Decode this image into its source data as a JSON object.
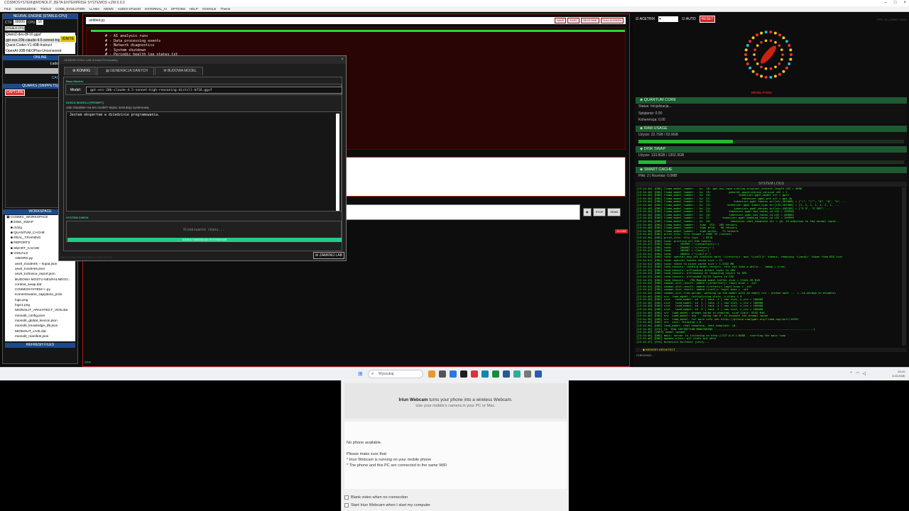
{
  "window": {
    "title": "COSMOSYSTEM@MONOLIT_BETA ENTERPRISE SYSTEMOS v.ZM 6.0.0",
    "menu": [
      "FILE",
      "KNOWLEDGE",
      "TOOLS",
      "CODE_EVOLUTION",
      "LLAMA",
      "NEWS",
      "AUDIO STUDIO",
      "EXTERNAL_AI",
      "OPTIONS",
      "HELP",
      "GOOGLE",
      "Theme"
    ]
  },
  "sidebar": {
    "engine_header": "NEURAL ENGINE [STABLE-CPU]",
    "ctx_label": "CTX",
    "ctx_value": "99999",
    "cpu_label": "CPU",
    "cpu_value": "16",
    "model_select": "[STABLE CPU]",
    "ignite": "IGNITE",
    "models": [
      "Qwen2-dev-8F16.gguf",
      "gpt-oss-20b-claude-4.5-sonnet-high-rea",
      "Quest-Coder-V1-40B-Instruct",
      "OpenAI-20B-NEOPlus-Uncensored"
    ],
    "status": "ONLINE",
    "loading": "Ładowanie: 0%",
    "cache": "CACHE ON",
    "quarks_header": "QUARKS (SNIPPETS)",
    "capture": "CAPTURE",
    "workspace_header": "WORKSPACE",
    "tree": [
      {
        "label": "COSMIC_WORKSPACE",
        "depth": 0
      },
      {
        "label": "DISK_SWAP",
        "depth": 1
      },
      {
        "label": "mózg",
        "depth": 1
      },
      {
        "label": "QUANTUM_CACHE",
        "depth": 1
      },
      {
        "label": "REAL_TRAINING",
        "depth": 1
      },
      {
        "label": "REPORTS",
        "depth": 1
      },
      {
        "label": "SMART_CACHE",
        "depth": 1
      },
      {
        "label": "VISUALS",
        "depth": 1
      },
      {
        "label": "AIBORG.py",
        "depth": 2
      },
      {
        "label": "arwir_incidents -- kopia.json",
        "depth": 2
      },
      {
        "label": "arwir_incidents.json",
        "depth": 2
      },
      {
        "label": "arwir_turbosca_report.json",
        "depth": 2
      },
      {
        "label": "BUDOWA MOSTU NEURALNEGO...",
        "depth": 2
      },
      {
        "label": "context_swap.dat",
        "depth": 2
      },
      {
        "label": "COSMOSYSTEM++.py",
        "depth": 2
      },
      {
        "label": "Komentowane_zapytania_prob",
        "depth": 2
      },
      {
        "label": "logo.png",
        "depth": 2
      },
      {
        "label": "logo1.png",
        "depth": 2
      },
      {
        "label": "MIONOLIT_ARCHITECT_VDN.dat",
        "depth": 2
      },
      {
        "label": "mionolit_config.json",
        "depth": 2
      },
      {
        "label": "mionolit_global_lexicon.json",
        "depth": 2
      },
      {
        "label": "mionolit_knowledge_db.json",
        "depth": 2
      },
      {
        "label": "MIONOUT_LIVE.dat",
        "depth": 2
      },
      {
        "label": "mionolit_manifest.json",
        "depth": 2
      }
    ],
    "refresh": "REFRESH FILES"
  },
  "editor": {
    "file": "untitled.py",
    "buttons": [
      "SAVE",
      "EXEC",
      "RESTORE",
      "FULLSCREEN"
    ],
    "code": "  # - AI analysis runs\n  # - Data processing events\n  # - Network diagnostics\n  # - System shutdown\n  # - Periodic health log states.txt",
    "send_buttons": [
      "STOP",
      "SEND"
    ],
    "terminal_prompt": ">>>",
    "close_tag": "CLOSE"
  },
  "right_panel": {
    "acetrix": "ACETRIX",
    "auto": "AUTO",
    "reset": "RESET",
    "faint": "FPS: 18  |  ORBIT: 100%",
    "revelation": "REVELATION",
    "quantum_header": "QUANTUM CORE",
    "quantum_lines": [
      "Status: Inicjalizacja...",
      "Splątanie: 0.00",
      "Koherencja: 0.00"
    ],
    "ram_header": "RAM USAGE",
    "ram_text": "Użycie: 22.7GB / 63.9GB",
    "ram_fraction": 0.355,
    "disk_header": "DISK SWAP",
    "disk_text": "Użycie: 133.9GB / 1302.3GB",
    "disk_fraction": 0.103,
    "smart_header": "SMART CACHE",
    "smart_text": "Pliki: 2 | Rozmiar: 0.0MB",
    "syslog_header": "SYSTEM LOGS",
    "syslog": "[13:14:40] [DBG] llama_model_loader: - kv  18: gpt-oss.rope.scaling.original_context_length u32 = 4096\n[13:14:40] [DBG] llama_model_loader: - kv  19:           general.quantization_version u32 = 2\n[13:14:40] [DBG] llama_model_loader: - kv  20:                 tokenizer.ggml.model str = gpt2\n[13:14:40] [DBG] llama_model_loader: - kv  21:                   tokenizer.ggml.pre str = gpt-4o\n[13:14:40] [DBG] llama_model_loader: - kv  22:              tokenizer.ggml.tokens arr[str,201088] = [\"!\", \"\\\"\", \"#\", \"$\", \"%\", ...\n[13:14:40] [DBG] llama_model_loader: - kv  23:          tokenizer.ggml.token_type arr[i32,201088] = [1, 1, 1, 1, 1, 1, 1, ...\n[13:14:40] [DBG] llama_model_loader: - kv  24:              tokenizer.ggml.merges arr[str,446189] = [\"Ġ Ġ\", \"Ġ ĠĠĠ\", ...\n[13:14:40] [DBG] llama_model_loader: - kv  25:           tokenizer.ggml.bos_token_id u32 = 199998\n[13:14:40] [DBG] llama_model_loader: - kv  26:           tokenizer.ggml.eos_token_id u32 = 200002\n[13:14:40] [DBG] llama_model_loader: - kv  27:       tokenizer.ggml.padding_token_id u32 = 199999\n[13:14:40] [DBG] llama_model_loader: - kv  28:            tokenizer.chat_template str = {#- In addition to the normal input...\n[13:14:40] [DBG] llama_model_loader: - type  f32:  289 tensors\n[13:14:40] [DBG] llama_model_loader: - type bf16:   98 tensors\n[13:14:40] [DBG] llama_model_loader: - type mxfp4:   72 tensors\n[13:14:40] [DBG] print_info: file format = GGUF V3 (latest)\n[13:14:40] [DBG] print_info: file type   = BF16\n[13:14:41] [DBG] load: printing all EOG tokens:\n[13:14:41] [DBG] load:   - 199999 ('<|endoftext|>')\n[13:14:41] [DBG] load:   - 200002 ('<|return|>')\n[13:14:41] [DBG] load:   - 200007 ('<|end|>')\n[13:14:41] [DBG] load:   - 200012 ('<|call|>')\n[13:14:41] [DBG] load: special_eog_ids contains both '<|return|>' and '<|call|>' tokens, removing '<|end|>' token from EOG list\n[13:14:41] [DBG] load: special tokens cache size = 21\n[13:14:41] [DBG] load: token to piece cache size = 1.3332 MB\n[13:14:41] [DBG] load_tensors: loading model tensors, this can take a while... (mmap = true)\n[13:14:43] [DBG] load_tensors: offloading output layer to GPU\n[13:14:43] [DBG] load_tensors: offloading 24 repeating layers to GPU\n[13:14:43] [DBG] load_tensors: offloaded 25/25 layers to GPU\n[13:14:43] [DBG] load_tensors:   CPU_Mapped model buffer size = 13141.38 MiB\n[13:14:44] [DBG] common_init_result: added <|endoftext|> logit bias = -inf\n[13:14:44] [DBG] common_init_result: added <|return|> logit bias = -inf\n[13:14:44] [DBG] common_init_result: added <|call|> logit bias = -inf\n[13:14:44] [DBG] common_init_from_params: warming up the model with an empty run - please wait ... (--no-warmup to disable)\n[13:14:46] [DBG] srv  load_model: initializing slots, n_slots = 4\n[13:14:46] [DBG] slot   load_model: id  0 | task -1 | new slot, n_ctx = 100000\n[13:14:46] [DBG] slot   load_model: id  1 | task -1 | new slot, n_ctx = 100000\n[13:14:46] [DBG] slot   load_model: id  2 | task -1 | new slot, n_ctx = 100000\n[13:14:46] [DBG] slot   load_model: id  3 | task -1 | new slot, n_ctx = 100000\n[13:14:46] [DBG] srv  load_model: prompt cache is enabled, size limit: 8192 MiB\n[13:14:46] [DBG] srv  load_model: use `--cache-ram 0` to disable the prompt cache\n[13:14:46] [DBG] srv  load_model: for more info see https://github.com/ggml-org/llama.cpp/pull/16391\n[13:14:46] [DBG] srv  init: thinking = 0\n[13:14:46] [DBG] load_model: chat template, chat_template: {#-\n[13:14:46] [SYS] [m- TOOL DEFINITION MONITORING -------------------------------------------------------------]\n[13:14:46] [INFO] model loaded\n[13:14:46] [DBG] main: server is listening on http://127.0.0.1:8080 - starting the main loop\n[13:14:46] [DBG] update_slots: all slots are idle\n[13:14:47] [SYS] Autocycle Kortekst (inst)...",
    "memory_header": "MEMORY ARCHITECT",
    "checking": "CHECKING..."
  },
  "dialog": {
    "title": "GENESIS SOUL LAB (Cloned Personality)",
    "tabs": [
      "KONFIG",
      "GENERACJA DANYCH",
      "BUDOWA MODEL"
    ],
    "base_label": "Baza Modelu",
    "model_label": "Model:",
    "model_value": "gpt-oss-20b-claude-4.5-sonnet-high-reasoning-distill-bf16.gguf",
    "soul_label": "DUSZA MODELU (PROMPT)",
    "soul_sub": "Jaki charakter ma ten model? Wpisz instrukcję systemową",
    "soul_text": "Jestem ekspertem w dziedzinie programowania.",
    "syscheck_label": "SYSTEM CHECK",
    "waiting": "Oczekiwanie skanu...",
    "scan_button": "SZUKAJ NARZĘDZIA SYSTEMOWE",
    "footer": "WROCŁAW  FRONTEND/CLOUD SUITE",
    "close": "ZAMKNIJ LAB"
  },
  "taskbar": {
    "search_placeholder": "Wyszukaj",
    "time": "13:15",
    "date": "4.03.2026"
  },
  "webcam": {
    "brand": "Iriun Webcam",
    "line1_rest": " turns your phone into a wireless Webcam.",
    "line2": "Use your mobile's camera in your PC or Mac.",
    "no_phone": "No phone available.",
    "ensure": "Please make sure that:",
    "bullet1": "* Iriun Webcam is running on your mobile phone",
    "bullet2": "* The phone and this PC are connected to the same WiFi",
    "check1": "Blank video when no connection",
    "check2": "Start Iriun Webcam when I start my computer"
  },
  "colors": {
    "accent_blue": "#1c4a8c",
    "accent_green": "#22bb33",
    "danger_red": "#cc2222"
  }
}
